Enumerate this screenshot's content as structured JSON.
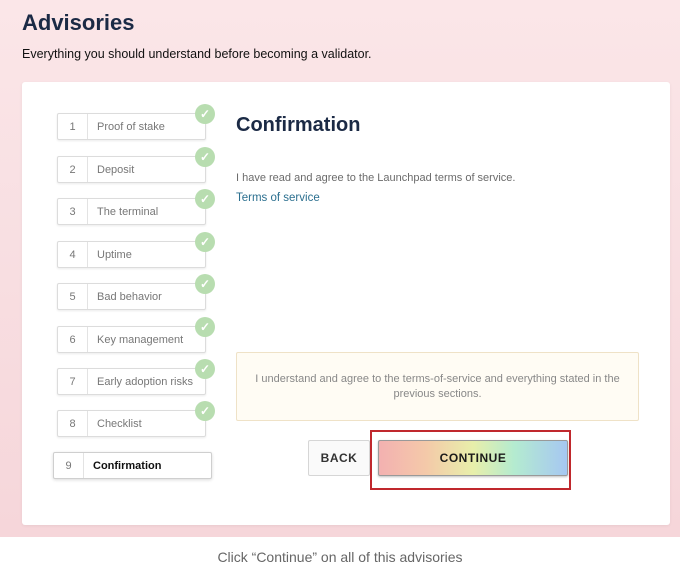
{
  "header": {
    "title": "Advisories",
    "subtitle": "Everything you should understand before becoming a validator."
  },
  "steps": [
    {
      "num": "1",
      "label": "Proof of stake",
      "completed": true
    },
    {
      "num": "2",
      "label": "Deposit",
      "completed": true
    },
    {
      "num": "3",
      "label": "The terminal",
      "completed": true
    },
    {
      "num": "4",
      "label": "Uptime",
      "completed": true
    },
    {
      "num": "5",
      "label": "Bad behavior",
      "completed": true
    },
    {
      "num": "6",
      "label": "Key management",
      "completed": true
    },
    {
      "num": "7",
      "label": "Early adoption risks",
      "completed": true
    },
    {
      "num": "8",
      "label": "Checklist",
      "completed": true
    },
    {
      "num": "9",
      "label": "Confirmation",
      "completed": false,
      "active": true
    }
  ],
  "content": {
    "heading": "Confirmation",
    "body": "I have read and agree to the Launchpad terms of service.",
    "link": "Terms of service",
    "agreement": "I understand and agree to the terms-of-service and everything stated in the previous sections."
  },
  "buttons": {
    "back": "BACK",
    "continue": "CONTINUE"
  },
  "caption": "Click “Continue” on all of this advisories",
  "colors": {
    "heading": "#1b2a45",
    "check": "#b8ddb0",
    "highlight": "#c0282d",
    "link": "#2b6f8f"
  }
}
